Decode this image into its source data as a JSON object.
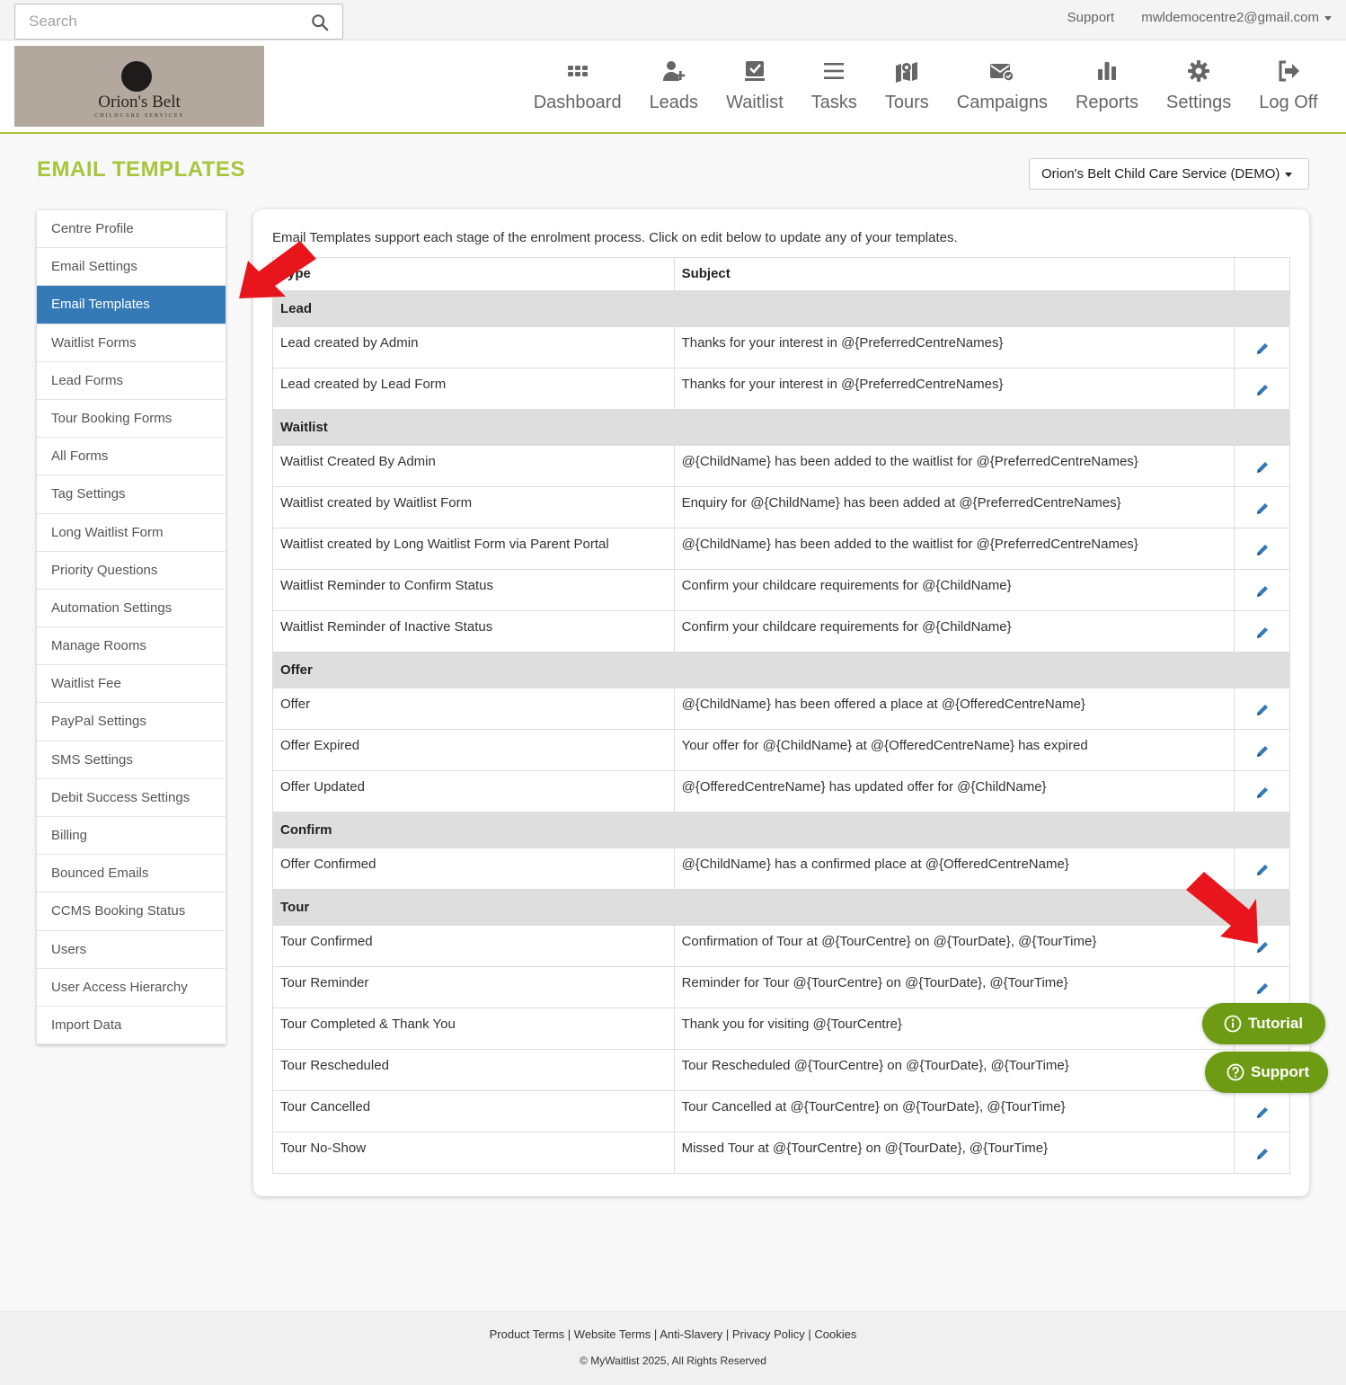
{
  "topbar": {
    "search_placeholder": "Search",
    "support": "Support",
    "account": "mwldemocentre2@gmail.com"
  },
  "logo": {
    "name": "Orion's Belt",
    "sub": "CHILDCARE SERVICES"
  },
  "nav": [
    {
      "label": "Dashboard",
      "icon": "grid-icon"
    },
    {
      "label": "Leads",
      "icon": "user-plus-icon"
    },
    {
      "label": "Waitlist",
      "icon": "checkbox-icon"
    },
    {
      "label": "Tasks",
      "icon": "list-icon"
    },
    {
      "label": "Tours",
      "icon": "map-icon"
    },
    {
      "label": "Campaigns",
      "icon": "envelope-icon"
    },
    {
      "label": "Reports",
      "icon": "bar-chart-icon"
    },
    {
      "label": "Settings",
      "icon": "gear-icon"
    },
    {
      "label": "Log Off",
      "icon": "sign-out-icon"
    }
  ],
  "page": {
    "title": "EMAIL TEMPLATES",
    "centre": "Orion's Belt Child Care Service (DEMO)"
  },
  "sidemenu": [
    "Centre Profile",
    "Email Settings",
    "Email Templates",
    "Waitlist Forms",
    "Lead Forms",
    "Tour Booking Forms",
    "All Forms",
    "Tag Settings",
    "Long Waitlist Form",
    "Priority Questions",
    "Automation Settings",
    "Manage Rooms",
    "Waitlist Fee",
    "PayPal Settings",
    "SMS Settings",
    "Debit Success Settings",
    "Billing",
    "Bounced Emails",
    "CCMS Booking Status",
    "Users",
    "User Access Hierarchy",
    "Import Data"
  ],
  "active_menu": "Email Templates",
  "panel": {
    "intro": "Email Templates support each stage of the enrolment process. Click on edit below to update any of your templates.",
    "col_type": "Type",
    "col_subject": "Subject",
    "groups": [
      {
        "name": "Lead",
        "rows": [
          {
            "type": "Lead created by Admin",
            "subject": "Thanks for your interest in @{PreferredCentreNames}"
          },
          {
            "type": "Lead created by Lead Form",
            "subject": "Thanks for your interest in @{PreferredCentreNames}"
          }
        ]
      },
      {
        "name": "Waitlist",
        "rows": [
          {
            "type": "Waitlist Created By Admin",
            "subject": "@{ChildName} has been added to the waitlist for @{PreferredCentreNames}"
          },
          {
            "type": "Waitlist created by Waitlist Form",
            "subject": "Enquiry for @{ChildName} has been added at @{PreferredCentreNames}"
          },
          {
            "type": "Waitlist created by Long Waitlist Form via Parent Portal",
            "subject": "@{ChildName} has been added to the waitlist for @{PreferredCentreNames}"
          },
          {
            "type": "Waitlist Reminder to Confirm Status",
            "subject": "Confirm your childcare requirements for @{ChildName}"
          },
          {
            "type": "Waitlist Reminder of Inactive Status",
            "subject": "Confirm your childcare requirements for @{ChildName}"
          }
        ]
      },
      {
        "name": "Offer",
        "rows": [
          {
            "type": "Offer",
            "subject": "@{ChildName} has been offered a place at @{OfferedCentreName}"
          },
          {
            "type": "Offer Expired",
            "subject": "Your offer for @{ChildName} at @{OfferedCentreName} has expired"
          },
          {
            "type": "Offer Updated",
            "subject": "@{OfferedCentreName} has updated offer for @{ChildName}"
          }
        ]
      },
      {
        "name": "Confirm",
        "rows": [
          {
            "type": "Offer Confirmed",
            "subject": "@{ChildName} has a confirmed place at @{OfferedCentreName}"
          }
        ]
      },
      {
        "name": "Tour",
        "rows": [
          {
            "type": "Tour Confirmed",
            "subject": "Confirmation of Tour at @{TourCentre} on @{TourDate}, @{TourTime}"
          },
          {
            "type": "Tour Reminder",
            "subject": "Reminder for Tour @{TourCentre} on @{TourDate}, @{TourTime}"
          },
          {
            "type": "Tour Completed & Thank You",
            "subject": "Thank you for visiting @{TourCentre}"
          },
          {
            "type": "Tour Rescheduled",
            "subject": "Tour Rescheduled @{TourCentre} on @{TourDate}, @{TourTime}"
          },
          {
            "type": "Tour Cancelled",
            "subject": "Tour Cancelled at @{TourCentre} on @{TourDate}, @{TourTime}"
          },
          {
            "type": "Tour No-Show",
            "subject": "Missed Tour at @{TourCentre} on @{TourDate}, @{TourTime}"
          }
        ]
      }
    ]
  },
  "fab": {
    "tutorial": "Tutorial",
    "support": "Support"
  },
  "footer": {
    "links": [
      "Product Terms",
      "Website Terms",
      "Anti-Slavery",
      "Privacy Policy",
      "Cookies"
    ],
    "copyright": "© MyWaitlist 2025, All Rights Reserved"
  },
  "colors": {
    "brand_green": "#a7c63b",
    "active_blue": "#337ab7",
    "fab_green": "#6d9c14",
    "edit_blue": "#337ab7",
    "arrow_red": "#e8151c"
  }
}
